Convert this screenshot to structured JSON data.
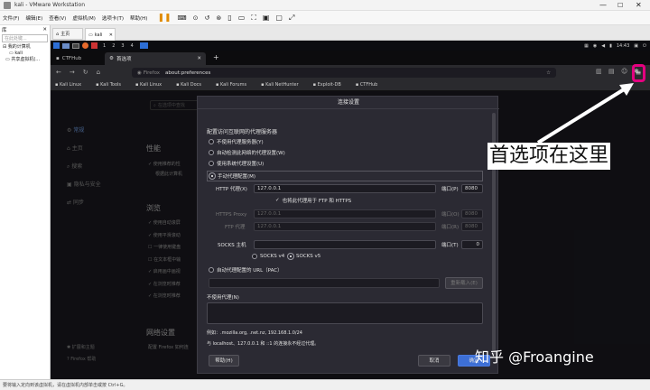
{
  "vmware": {
    "title": "kali - VMware Workstation",
    "menu": [
      "文件(F)",
      "编辑(E)",
      "查看(V)",
      "虚拟机(M)",
      "选项卡(T)",
      "帮助(H)"
    ],
    "library_label": "库",
    "search_placeholder": "在此处键...",
    "tree": [
      "我的计算机",
      "kali",
      "共享虚拟机(..."
    ],
    "tabs": [
      "主页",
      "kali"
    ],
    "status": "要将输入定向到该虚拟机，请在虚拟机内部单击或按 Ctrl+G。"
  },
  "kali": {
    "workspaces": [
      "1",
      "2",
      "3",
      "4"
    ],
    "clock": "14:43"
  },
  "firefox": {
    "tabs": [
      "CTFHub",
      "首选项"
    ],
    "new_tab": "+",
    "url_prefix": "Firefox",
    "url": "about:preferences",
    "bookmarks": [
      "Kali Linux",
      "Kali Tools",
      "Kali Linux",
      "Kali Docs",
      "Kali Forums",
      "Kali NetHunter",
      "Exploit-DB",
      "CTFHub"
    ],
    "search_hint": "在选项中查找"
  },
  "prefs": {
    "sidebar": [
      "常规",
      "主页",
      "搜索",
      "隐私与安全",
      "同步"
    ],
    "sidebar_bottom": [
      "扩展和主题",
      "Firefox 帮助"
    ],
    "perf_heading": "性能",
    "perf_items": [
      "使用推荐的性",
      "根据此计算机"
    ],
    "browse_heading": "浏览",
    "browse_items": [
      "使用自动滚屏",
      "使用平滑滚动",
      "一律使用键盘",
      "在文本框中输",
      "启用画中画视",
      "在浏览时推荐",
      "在浏览时推荐"
    ],
    "network_heading": "网络设置",
    "network_text": "配置 Firefox 如何连"
  },
  "dialog": {
    "title": "连接设置",
    "heading": "配置访问互联网的代理服务器",
    "options": [
      "不使用代理服务器(Y)",
      "自动检测此网络的代理设置(W)",
      "使用系统代理设置(U)",
      "手动代理配置(M)"
    ],
    "http_label": "HTTP 代理(X)",
    "http_value": "127.0.0.1",
    "port_label": "端口(P)",
    "http_port": "8080",
    "also_https": "也将此代理用于 FTP 和 HTTPS",
    "https_label": "HTTPS Proxy",
    "https_value": "127.0.0.1",
    "https_port_label": "端口(O)",
    "https_port": "8080",
    "ftp_label": "FTP 代理",
    "ftp_value": "127.0.0.1",
    "ftp_port_label": "端口(R)",
    "ftp_port": "8080",
    "socks_label": "SOCKS 主机",
    "socks_port_label": "端口(T)",
    "socks_port": "0",
    "socks_v4": "SOCKS v4",
    "socks_v5": "SOCKS v5",
    "auto_url": "自动代理配置的 URL（PAC）",
    "reload": "重新载入(E)",
    "no_proxy_label": "不使用代理(N)",
    "example": "例如：.mozilla.org, .net.nz, 192.168.1.0/24",
    "localhost_note": "与 localhost、127.0.0.1 和 ::1 的连接永不经过代理。",
    "help": "帮助(H)",
    "cancel": "取消",
    "ok": "确定"
  },
  "annotation": {
    "text": "首选项在这里",
    "watermark": "知乎 @Froangine",
    "color": "#e4007f"
  }
}
